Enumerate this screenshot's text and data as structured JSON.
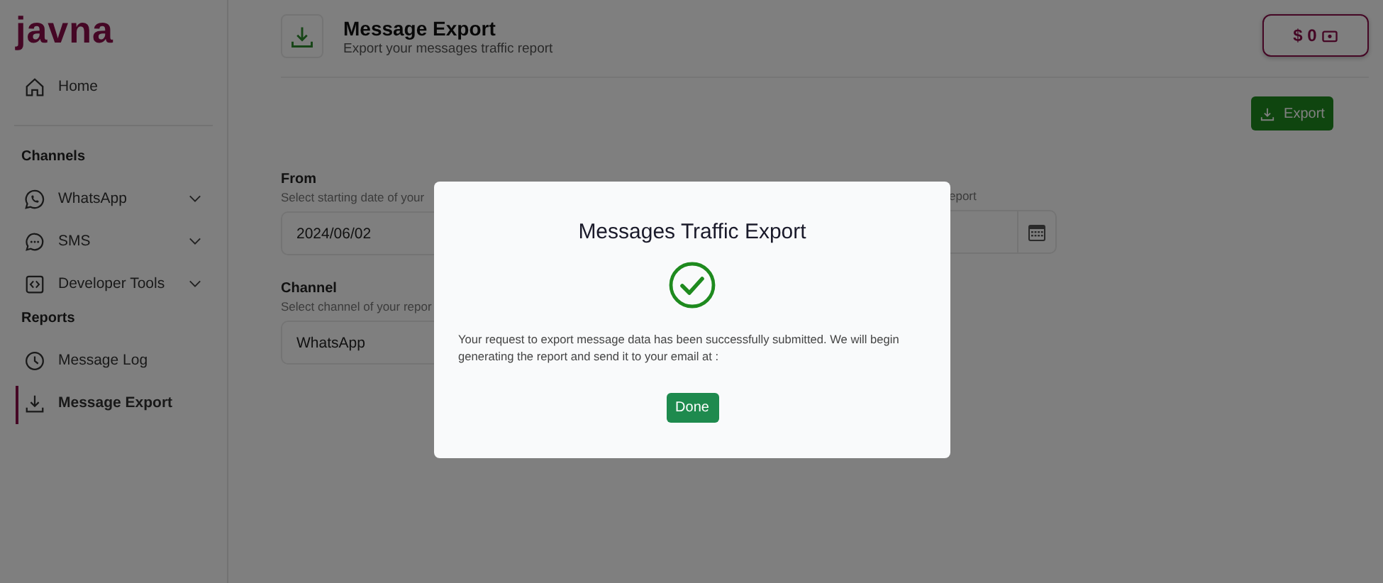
{
  "logo": "javna",
  "sidebar": {
    "items": [
      {
        "label": "Home",
        "kind": "home",
        "selected": false
      }
    ],
    "sections": [
      {
        "title": "Channels",
        "items": [
          {
            "label": "WhatsApp",
            "kind": "whatsapp",
            "expanded": false,
            "selected": false
          },
          {
            "label": "SMS",
            "kind": "chat",
            "expanded": false,
            "selected": false
          },
          {
            "label": "Developer Tools",
            "kind": "code",
            "expanded": false,
            "selected": false
          }
        ]
      },
      {
        "title": "Reports",
        "items": [
          {
            "label": "Message Log",
            "kind": "clock",
            "selected": false
          },
          {
            "label": "Message Export",
            "kind": "download",
            "selected": true
          }
        ]
      }
    ]
  },
  "header": {
    "title": "Message Export",
    "subtitle": "Export your messages traffic report",
    "balance": "$ 0"
  },
  "export_button": "Export",
  "form": {
    "from": {
      "label": "From",
      "hint": "Select starting date of your",
      "value": "2024/06/02"
    },
    "to": {
      "hint": "eport"
    },
    "channel": {
      "label": "Channel",
      "hint": "Select channel of your repor",
      "value": "WhatsApp"
    }
  },
  "dialog": {
    "title": "Messages Traffic Export",
    "message": "Your request to export message data has been successfully submitted. We will begin generating the report and send it to your email at :",
    "button": "Done"
  }
}
